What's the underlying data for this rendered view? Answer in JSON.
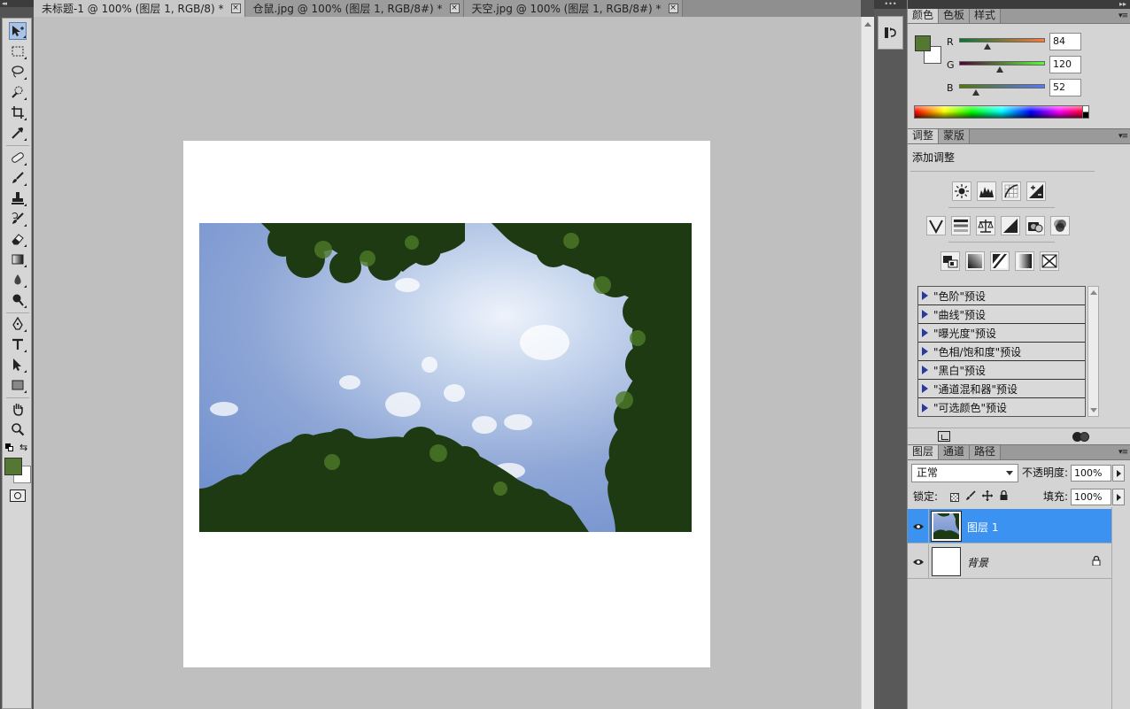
{
  "toolbox": {
    "collapse_arrows": "◂◂"
  },
  "document_tabs": [
    {
      "label": "未标题-1 @ 100% (图层 1, RGB/8) *",
      "active": true
    },
    {
      "label": "仓鼠.jpg @ 100% (图层 1, RGB/8#) *",
      "active": false
    },
    {
      "label": "天空.jpg @ 100% (图层 1, RGB/8#) *",
      "active": false
    }
  ],
  "tab_close_glyph": "×",
  "panels_collapse_arrows": "▸▸",
  "color_panel": {
    "tabs": [
      "颜色",
      "色板",
      "样式"
    ],
    "foreground": "#547834",
    "background": "#ffffff",
    "channels": [
      {
        "label": "R",
        "value": "84",
        "fraction": 0.33
      },
      {
        "label": "G",
        "value": "120",
        "fraction": 0.47
      },
      {
        "label": "B",
        "value": "52",
        "fraction": 0.2
      }
    ]
  },
  "adjustments_panel": {
    "tabs": [
      "调整",
      "蒙版"
    ],
    "title": "添加调整",
    "icon_rows": [
      [
        "brightness-contrast-icon",
        "levels-icon",
        "curves-icon",
        "exposure-icon"
      ],
      [
        "vibrance-icon",
        "hue-saturation-icon",
        "color-balance-icon",
        "black-white-icon",
        "photo-filter-icon",
        "channel-mixer-icon"
      ],
      [
        "invert-icon",
        "posterize-icon",
        "threshold-icon",
        "gradient-map-icon",
        "selective-color-icon"
      ]
    ],
    "presets": [
      "\"色阶\"预设",
      "\"曲线\"预设",
      "\"曝光度\"预设",
      "\"色相/饱和度\"预设",
      "\"黑白\"预设",
      "\"通道混和器\"预设",
      "\"可选颜色\"预设"
    ]
  },
  "layers_panel": {
    "tabs": [
      "图层",
      "通道",
      "路径"
    ],
    "blend_mode": "正常",
    "opacity_label": "不透明度:",
    "opacity_value": "100%",
    "lock_label": "锁定:",
    "fill_label": "填充:",
    "fill_value": "100%",
    "layers": [
      {
        "name": "图层 1",
        "selected": true
      },
      {
        "name": "背景",
        "selected": false,
        "locked": true
      }
    ]
  },
  "accent_color": "#3b92f0"
}
